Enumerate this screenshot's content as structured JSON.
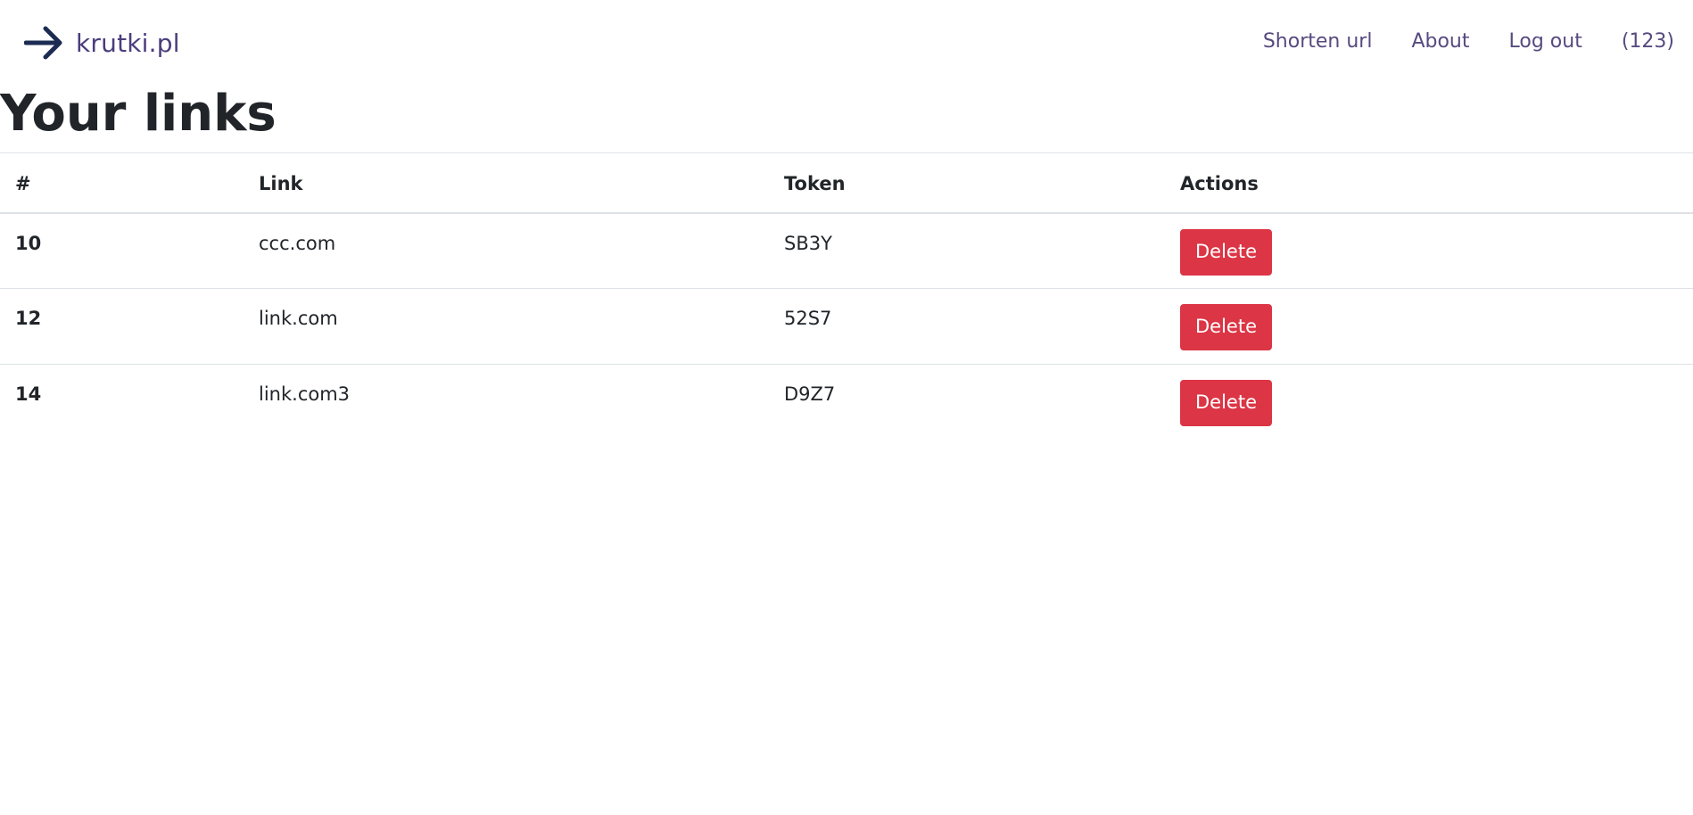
{
  "nav": {
    "brand": "krutki.pl",
    "brand_icon": "arrow-right-icon",
    "links": [
      "Shorten url",
      "About",
      "Log out",
      "(123)"
    ]
  },
  "page": {
    "title": "Your links"
  },
  "table": {
    "headers": [
      "#",
      "Link",
      "Token",
      "Actions"
    ],
    "rows": [
      {
        "id": "10",
        "link": "ccc.com",
        "token": "SB3Y",
        "action": "Delete"
      },
      {
        "id": "12",
        "link": "link.com",
        "token": "52S7",
        "action": "Delete"
      },
      {
        "id": "14",
        "link": "link.com3",
        "token": "D9Z7",
        "action": "Delete"
      }
    ]
  },
  "colors": {
    "brand_text": "#4b3d7d",
    "nav_link": "#574a7f",
    "icon": "#1c2b52",
    "danger": "#dc3545"
  }
}
